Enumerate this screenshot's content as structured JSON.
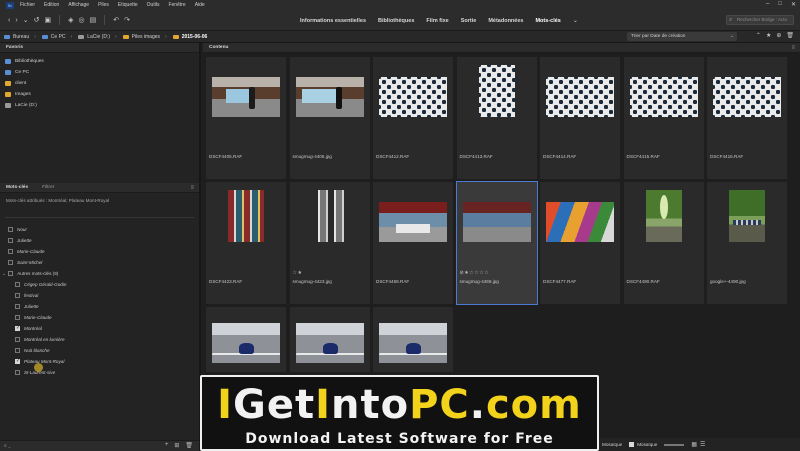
{
  "menubar": {
    "logo": "Br",
    "items": [
      "Fichier",
      "Edition",
      "Affichage",
      "Piles",
      "Etiquette",
      "Outils",
      "Fenêtre",
      "Aide"
    ]
  },
  "workspaces": {
    "tabs": [
      "Informations essentielles",
      "Bibliothèques",
      "Film fixe",
      "Sortie",
      "Métadonnées",
      "Mots-clés"
    ],
    "active": "Mots-clés"
  },
  "search": {
    "placeholder": "Rechercher Bridge : Actu"
  },
  "breadcrumb": [
    "Bureau",
    "Ce PC",
    "LaCie (D:)",
    "Piles images",
    "2015-06-06"
  ],
  "sort": {
    "label": "Trier par Date de création"
  },
  "favorites": {
    "title": "Favoris",
    "items": [
      {
        "label": "Bibliothèques",
        "color": "#5a8fd6"
      },
      {
        "label": "Ce PC",
        "color": "#5a8fd6"
      },
      {
        "label": "client",
        "color": "#e0a830"
      },
      {
        "label": "Images",
        "color": "#e0a830"
      },
      {
        "label": "LaCie (D:)",
        "color": "#9a9a9a"
      }
    ]
  },
  "keywords": {
    "tab_active": "Mots-clés",
    "tab_inactive": "Filtrer",
    "assigned": "Mots-clés attribués : Montréal; Plateau Mont-Royal",
    "top_items": [
      {
        "label": "Nour",
        "checked": false
      },
      {
        "label": "Juliette",
        "checked": false
      },
      {
        "label": "Marie-Claude",
        "checked": false
      },
      {
        "label": "Saint-Michel",
        "checked": false
      }
    ],
    "group": {
      "label": "Autres mots-clés (9)"
    },
    "children": [
      {
        "label": "Cégep Gérald-Godin",
        "checked": false
      },
      {
        "label": "festival",
        "checked": false
      },
      {
        "label": "Juliette",
        "checked": false
      },
      {
        "label": "Marie-Claude",
        "checked": false
      },
      {
        "label": "Montréal",
        "checked": true
      },
      {
        "label": "Montréal en lumière",
        "checked": false
      },
      {
        "label": "Nuit blanche",
        "checked": false
      },
      {
        "label": "Plateau Mont-Royal",
        "checked": true
      },
      {
        "label": "St-Laurent-sive",
        "checked": false
      }
    ]
  },
  "content": {
    "title": "Contenu",
    "thumbs": [
      {
        "name": "DSCF4405.RAF",
        "art": "street",
        "stars": ""
      },
      {
        "name": "smugmug-4405.jpg",
        "art": "street2",
        "stars": ""
      },
      {
        "name": "DSCF4412.RAF",
        "art": "pattern",
        "stars": ""
      },
      {
        "name": "DSCF4413.RAF",
        "art": "pattern",
        "stars": ""
      },
      {
        "name": "DSCF4414.RAF",
        "art": "pattern",
        "stars": ""
      },
      {
        "name": "DSCF4415.RAF",
        "art": "pattern",
        "stars": ""
      },
      {
        "name": "DSCF4416.RAF",
        "art": "pattern",
        "stars": ""
      },
      {
        "name": "DSCF4423.RAF",
        "art": "facade-color",
        "stars": ""
      },
      {
        "name": "smugmug-4423.jpg",
        "art": "facade-bw",
        "stars": "☆★"
      },
      {
        "name": "DSCF4469.RAF",
        "art": "booth",
        "stars": ""
      },
      {
        "name": "smugmug-4469.jpg",
        "art": "booth2",
        "stars": "⊘★☆☆☆☆"
      },
      {
        "name": "DSCF4477.RAF",
        "art": "graffiti",
        "stars": ""
      },
      {
        "name": "DSCF4490.RAF",
        "art": "trees",
        "stars": ""
      },
      {
        "name": "google+-4490.jpg",
        "art": "trees2",
        "stars": ""
      },
      {
        "name": "",
        "art": "road",
        "stars": ""
      },
      {
        "name": "",
        "art": "road",
        "stars": ""
      },
      {
        "name": "",
        "art": "road",
        "stars": ""
      }
    ]
  },
  "statusbar": {
    "view1": "Mosaïque",
    "view2": "Mosaïque"
  },
  "banner": {
    "title_i": "I",
    "title_mid1": "Get",
    "title_i2": "I",
    "title_mid2": "nto",
    "title_pc": "PC",
    "title_dot": ".",
    "title_com": "com",
    "subtitle": "Download Latest Software for Free"
  },
  "colors": {
    "selection": "#4b7bd1",
    "accent_folder": "#e0a830"
  }
}
